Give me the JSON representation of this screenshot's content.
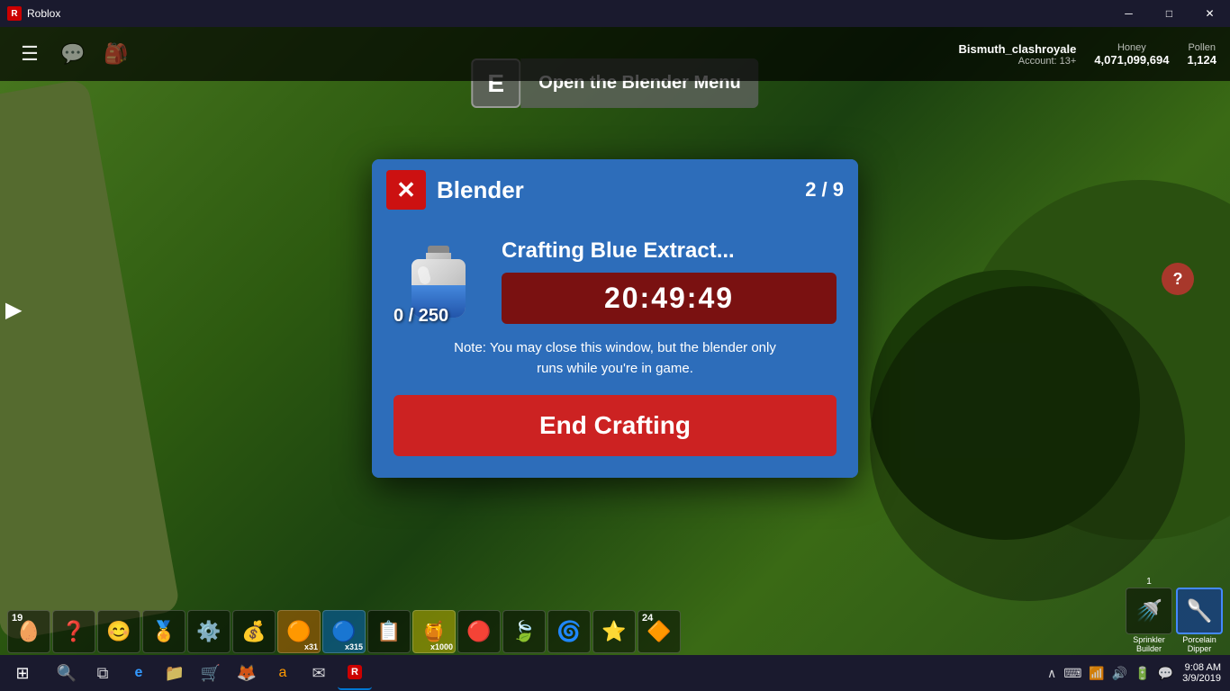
{
  "titlebar": {
    "app_name": "Roblox",
    "minimize": "─",
    "maximize": "□",
    "close": "✕"
  },
  "hud": {
    "username": "Bismuth_clashroyale",
    "account_label": "Account: 13+",
    "honey_label": "Honey",
    "honey_value": "4,071,099,694",
    "pollen_label": "Pollen",
    "pollen_value": "1,124"
  },
  "e_prompt": {
    "key": "E",
    "label": "Open the Blender Menu"
  },
  "modal": {
    "close_label": "✕",
    "title": "Blender",
    "page": "2 / 9",
    "crafting_title": "Crafting Blue Extract...",
    "item_count": "0 / 250",
    "timer": "20:49:49",
    "note": "Note: You may close this window, but the blender only\nruns while you're in game.",
    "end_btn": "End Crafting"
  },
  "hotbar": {
    "items": [
      {
        "icon": "🥚",
        "count": "19",
        "label": ""
      },
      {
        "icon": "❓",
        "count": "",
        "label": ""
      },
      {
        "icon": "😊",
        "count": "",
        "label": ""
      },
      {
        "icon": "🏅",
        "count": "",
        "label": ""
      },
      {
        "icon": "⚙️",
        "count": "",
        "label": ""
      },
      {
        "icon": "💰",
        "count": "",
        "label": ""
      },
      {
        "icon": "🟠",
        "count": "x31",
        "label": ""
      },
      {
        "icon": "🔵",
        "count": "x315",
        "label": ""
      },
      {
        "icon": "📋",
        "count": "",
        "label": ""
      },
      {
        "icon": "🟡",
        "count": "x1000",
        "label": ""
      },
      {
        "icon": "🔴",
        "count": "",
        "label": ""
      },
      {
        "icon": "🍃",
        "count": "",
        "label": ""
      },
      {
        "icon": "🌀",
        "count": "",
        "label": ""
      },
      {
        "icon": "⭐",
        "count": "",
        "label": ""
      },
      {
        "icon": "🔶",
        "count": "24",
        "label": ""
      }
    ],
    "sprinkler_count": "1",
    "sprinkler_label1": "Sprinkler",
    "sprinkler_label2": "Builder",
    "porcelain_label1": "Porcelain",
    "porcelain_label2": "Dipper"
  },
  "taskbar": {
    "time": "9:08 AM",
    "date": "3/9/2019",
    "start_icon": "⊞",
    "icons": [
      {
        "icon": "🔍",
        "name": "search"
      },
      {
        "icon": "🗂",
        "name": "task-view"
      },
      {
        "icon": "e",
        "name": "edge"
      },
      {
        "icon": "📁",
        "name": "file-explorer"
      },
      {
        "icon": "🛒",
        "name": "store"
      },
      {
        "icon": "🦊",
        "name": "firefox"
      },
      {
        "icon": "📦",
        "name": "amazon"
      },
      {
        "icon": "✉",
        "name": "mail"
      },
      {
        "icon": "🎮",
        "name": "roblox"
      }
    ]
  },
  "help_btn": "?",
  "cursor": "▶"
}
